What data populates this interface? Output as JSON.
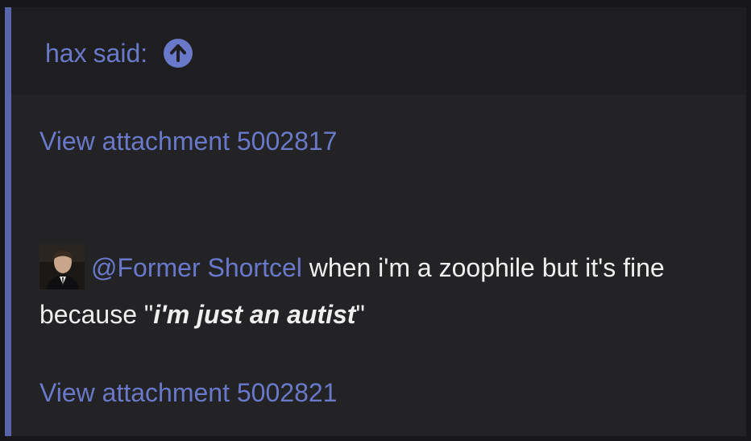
{
  "quote": {
    "author": "hax",
    "said_label": "said:",
    "jump_icon": "arrow-up-circle-icon",
    "accent_color": "#5865ad"
  },
  "attachments": [
    {
      "label": "View attachment 5002817"
    },
    {
      "label": "View attachment 5002821"
    }
  ],
  "post": {
    "avatar_icon": "user-avatar",
    "mention": "@Former Shortcel",
    "text_before_emphasis": " when i'm a zoophile but it's fine because \"",
    "emphasis": "i'm just an autist",
    "text_after_emphasis": "\""
  }
}
